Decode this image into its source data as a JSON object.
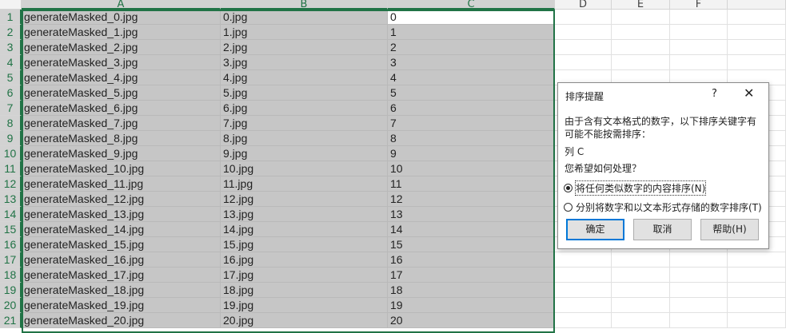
{
  "spreadsheet": {
    "columns": [
      "A",
      "B",
      "C",
      "D",
      "E",
      "F"
    ],
    "rows": [
      {
        "n": "1",
        "a": "generateMasked_0.jpg",
        "b": "0.jpg",
        "c": "0"
      },
      {
        "n": "2",
        "a": "generateMasked_1.jpg",
        "b": "1.jpg",
        "c": "1"
      },
      {
        "n": "3",
        "a": "generateMasked_2.jpg",
        "b": "2.jpg",
        "c": "2"
      },
      {
        "n": "4",
        "a": "generateMasked_3.jpg",
        "b": "3.jpg",
        "c": "3"
      },
      {
        "n": "5",
        "a": "generateMasked_4.jpg",
        "b": "4.jpg",
        "c": "4"
      },
      {
        "n": "6",
        "a": "generateMasked_5.jpg",
        "b": "5.jpg",
        "c": "5"
      },
      {
        "n": "7",
        "a": "generateMasked_6.jpg",
        "b": "6.jpg",
        "c": "6"
      },
      {
        "n": "8",
        "a": "generateMasked_7.jpg",
        "b": "7.jpg",
        "c": "7"
      },
      {
        "n": "9",
        "a": "generateMasked_8.jpg",
        "b": "8.jpg",
        "c": "8"
      },
      {
        "n": "10",
        "a": "generateMasked_9.jpg",
        "b": "9.jpg",
        "c": "9"
      },
      {
        "n": "11",
        "a": "generateMasked_10.jpg",
        "b": "10.jpg",
        "c": "10"
      },
      {
        "n": "12",
        "a": "generateMasked_11.jpg",
        "b": "11.jpg",
        "c": "11"
      },
      {
        "n": "13",
        "a": "generateMasked_12.jpg",
        "b": "12.jpg",
        "c": "12"
      },
      {
        "n": "14",
        "a": "generateMasked_13.jpg",
        "b": "13.jpg",
        "c": "13"
      },
      {
        "n": "15",
        "a": "generateMasked_14.jpg",
        "b": "14.jpg",
        "c": "14"
      },
      {
        "n": "16",
        "a": "generateMasked_15.jpg",
        "b": "15.jpg",
        "c": "15"
      },
      {
        "n": "17",
        "a": "generateMasked_16.jpg",
        "b": "16.jpg",
        "c": "16"
      },
      {
        "n": "18",
        "a": "generateMasked_17.jpg",
        "b": "17.jpg",
        "c": "17"
      },
      {
        "n": "19",
        "a": "generateMasked_18.jpg",
        "b": "18.jpg",
        "c": "18"
      },
      {
        "n": "20",
        "a": "generateMasked_19.jpg",
        "b": "19.jpg",
        "c": "19"
      },
      {
        "n": "21",
        "a": "generateMasked_20.jpg",
        "b": "20.jpg",
        "c": "20"
      }
    ]
  },
  "dialog": {
    "title": "排序提醒",
    "help": "?",
    "close": "✕",
    "message_line1": "由于含有文本格式的数字，以下排序关键字有",
    "message_line2": "可能不能按需排序：",
    "column_ref": "列 C",
    "question": "您希望如何处理？",
    "option1": "将任何类似数字的内容排序(N)",
    "option2": "分别将数字和以文本形式存储的数字排序(T)",
    "ok": "确定",
    "cancel": "取消",
    "helpbtn": "帮助(H)"
  },
  "colors": {
    "selection_border": "#217346",
    "selected_fill": "#c6c6c6",
    "default_button_border": "#0078d7"
  }
}
